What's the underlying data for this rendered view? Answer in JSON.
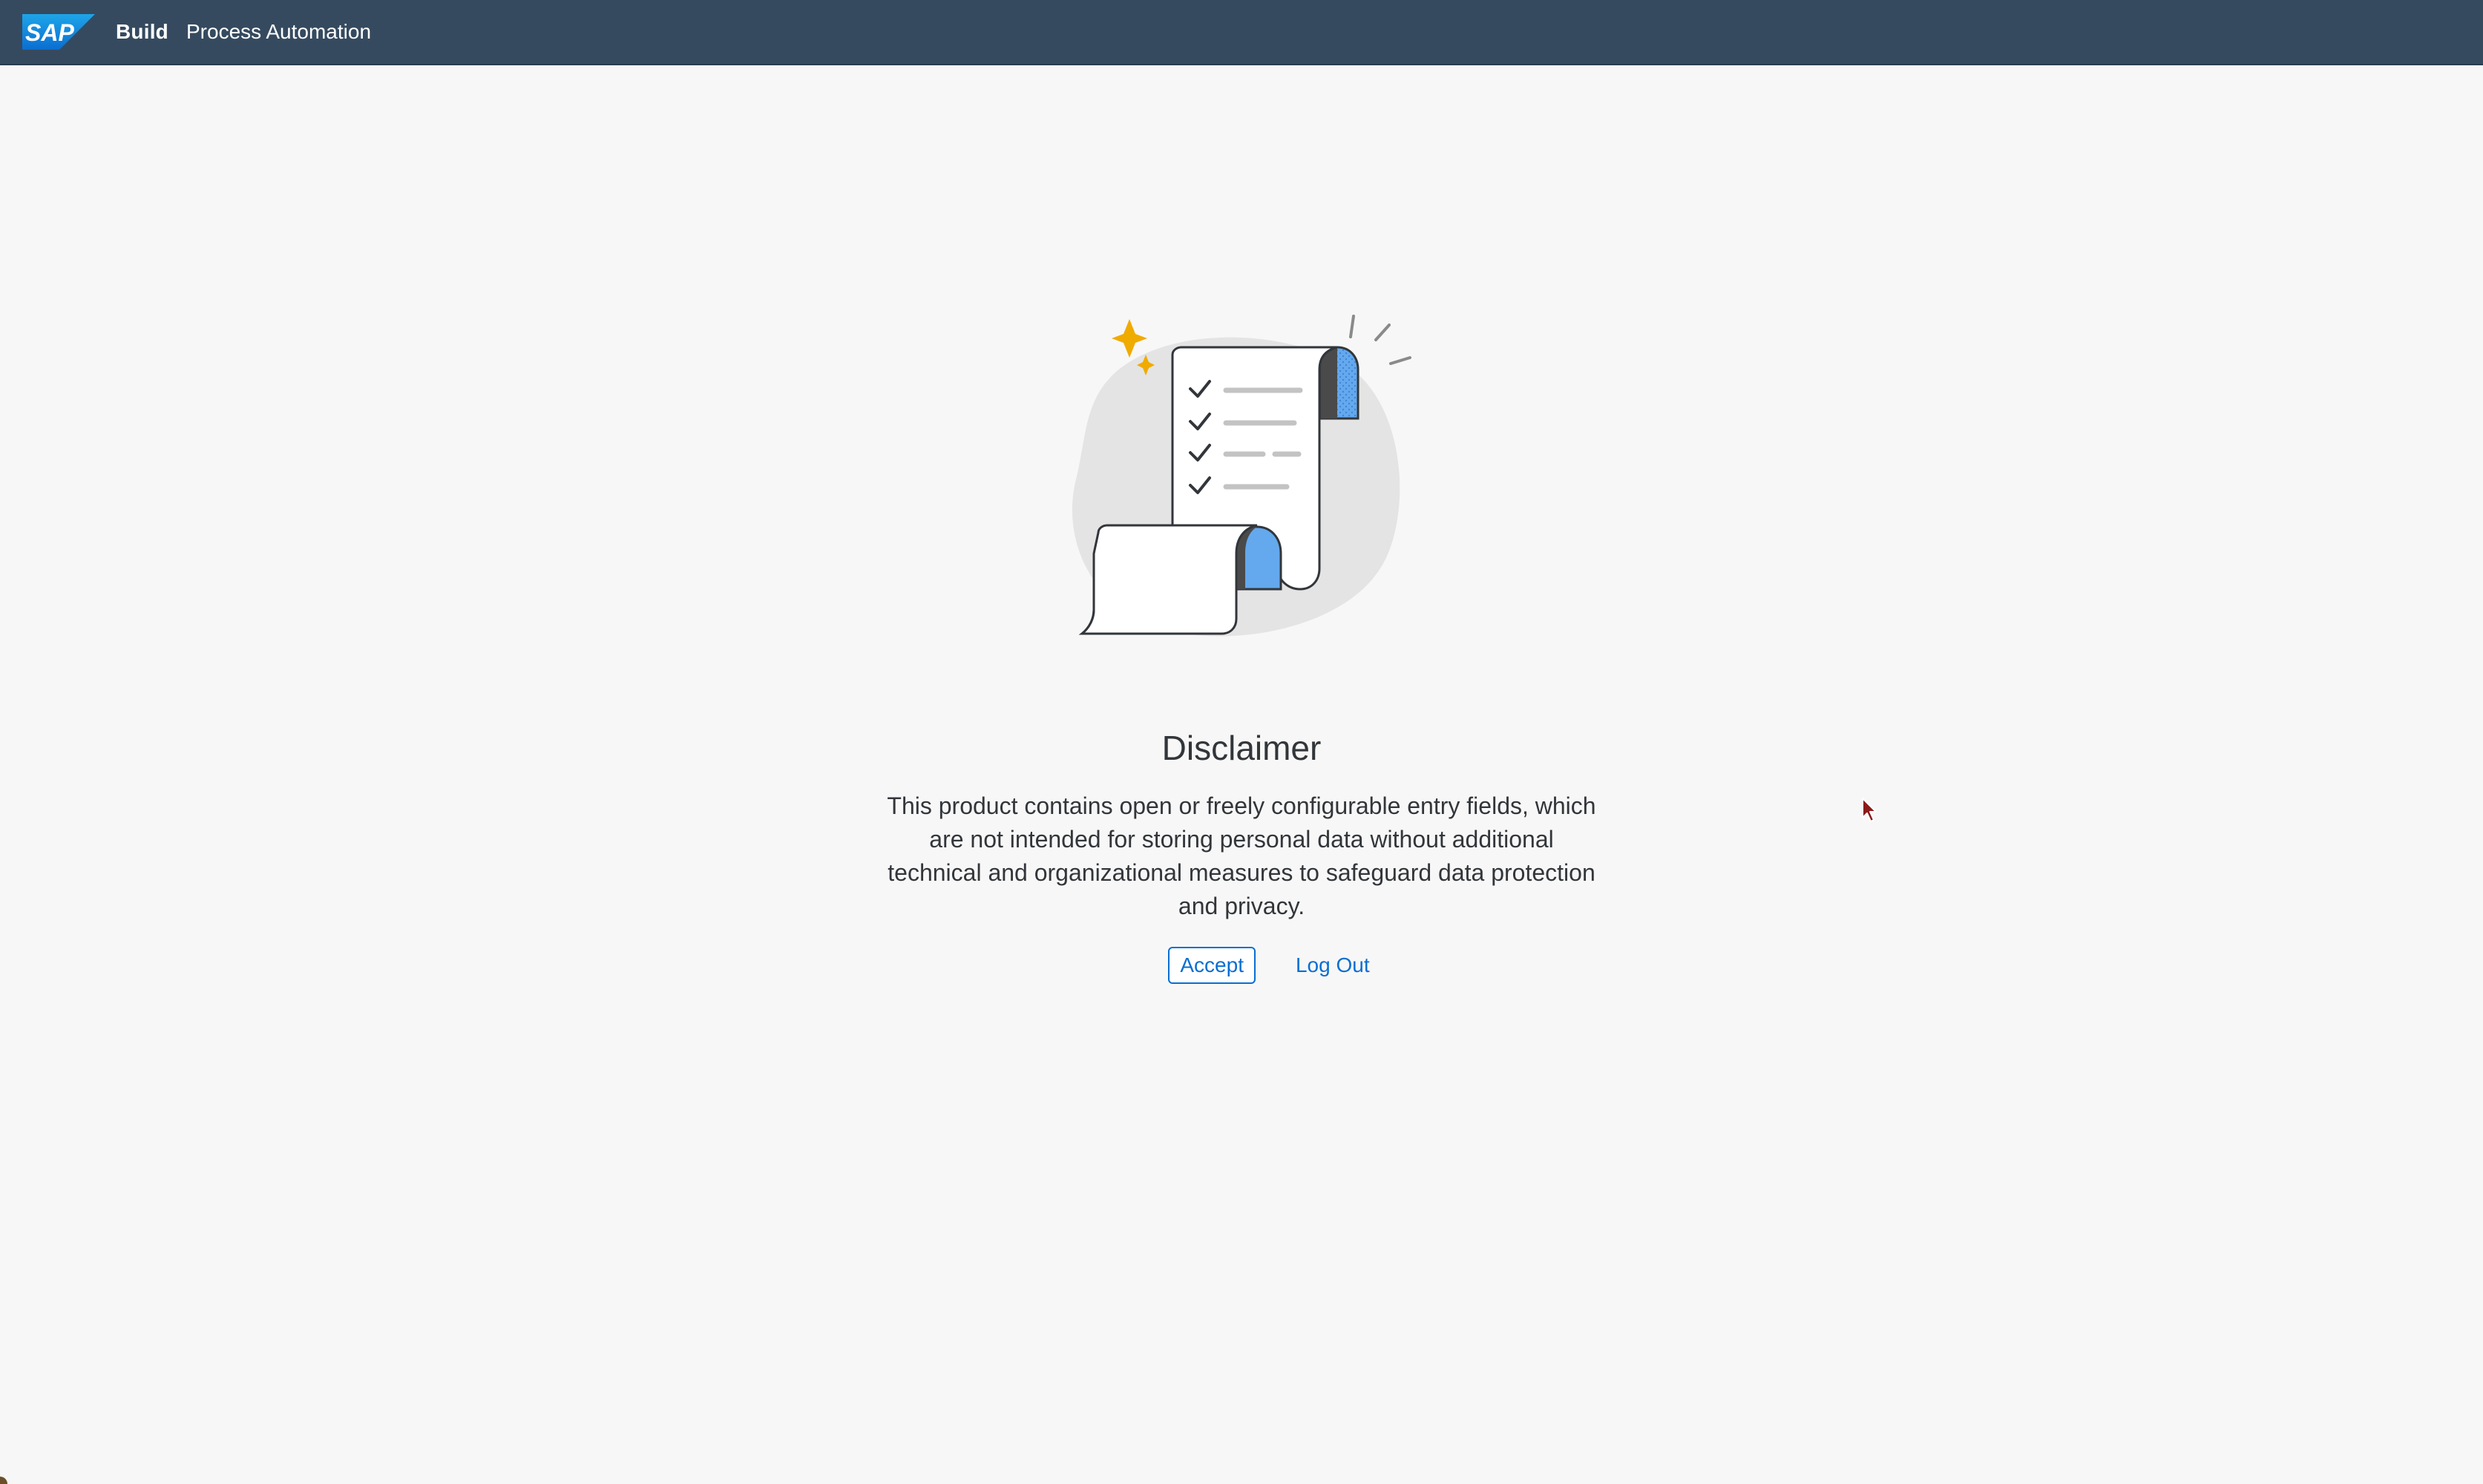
{
  "shell": {
    "logo_text": "SAP",
    "brand": "Build",
    "product": "Process Automation"
  },
  "dialog": {
    "title": "Disclaimer",
    "message": "This product contains open or freely configurable entry fields, which are not intended for storing personal data without additional technical and organizational measures to safeguard data protection and privacy.",
    "accept_label": "Accept",
    "logout_label": "Log Out"
  },
  "colors": {
    "shell_background": "#354a5f",
    "page_background": "#f7f7f7",
    "link_blue": "#0a6ed1",
    "illustration_blue": "#64a8ee",
    "illustration_gold": "#f0ab00"
  },
  "icons": {
    "illustration": "document-scroll-checklist-illustration",
    "pointer": "mouse-cursor-icon"
  }
}
